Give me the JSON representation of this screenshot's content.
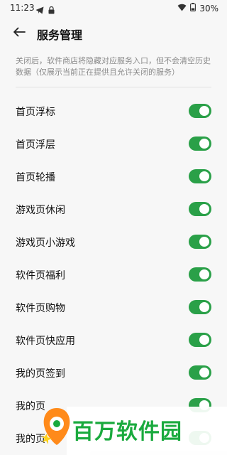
{
  "status_bar": {
    "time": "11:23",
    "battery": "30%",
    "icons_left": [
      "telegram-icon",
      "lock-icon"
    ],
    "icons_right": [
      "wifi-icon",
      "battery-icon"
    ]
  },
  "header": {
    "title": "服务管理",
    "back_icon": "arrow-left-icon"
  },
  "description": "关闭后，软件商店将隐藏对应服务入口，但不会清空历史数据（仅展示当前正在提供且允许关闭的服务）",
  "settings": [
    {
      "label": "首页浮标",
      "enabled": true
    },
    {
      "label": "首页浮层",
      "enabled": true
    },
    {
      "label": "首页轮播",
      "enabled": true
    },
    {
      "label": "游戏页休闲",
      "enabled": true
    },
    {
      "label": "游戏页小游戏",
      "enabled": true
    },
    {
      "label": "软件页福利",
      "enabled": true
    },
    {
      "label": "软件页购物",
      "enabled": true
    },
    {
      "label": "软件页快应用",
      "enabled": true
    },
    {
      "label": "我的页签到",
      "enabled": true
    },
    {
      "label": "我的页",
      "enabled": true
    },
    {
      "label": "我的页",
      "enabled": true
    }
  ],
  "watermark": {
    "text": "百万软件园"
  },
  "colors": {
    "toggle_on": "#2aa048",
    "background": "#f7f7f7",
    "watermark_green": "#1aaa3e"
  }
}
